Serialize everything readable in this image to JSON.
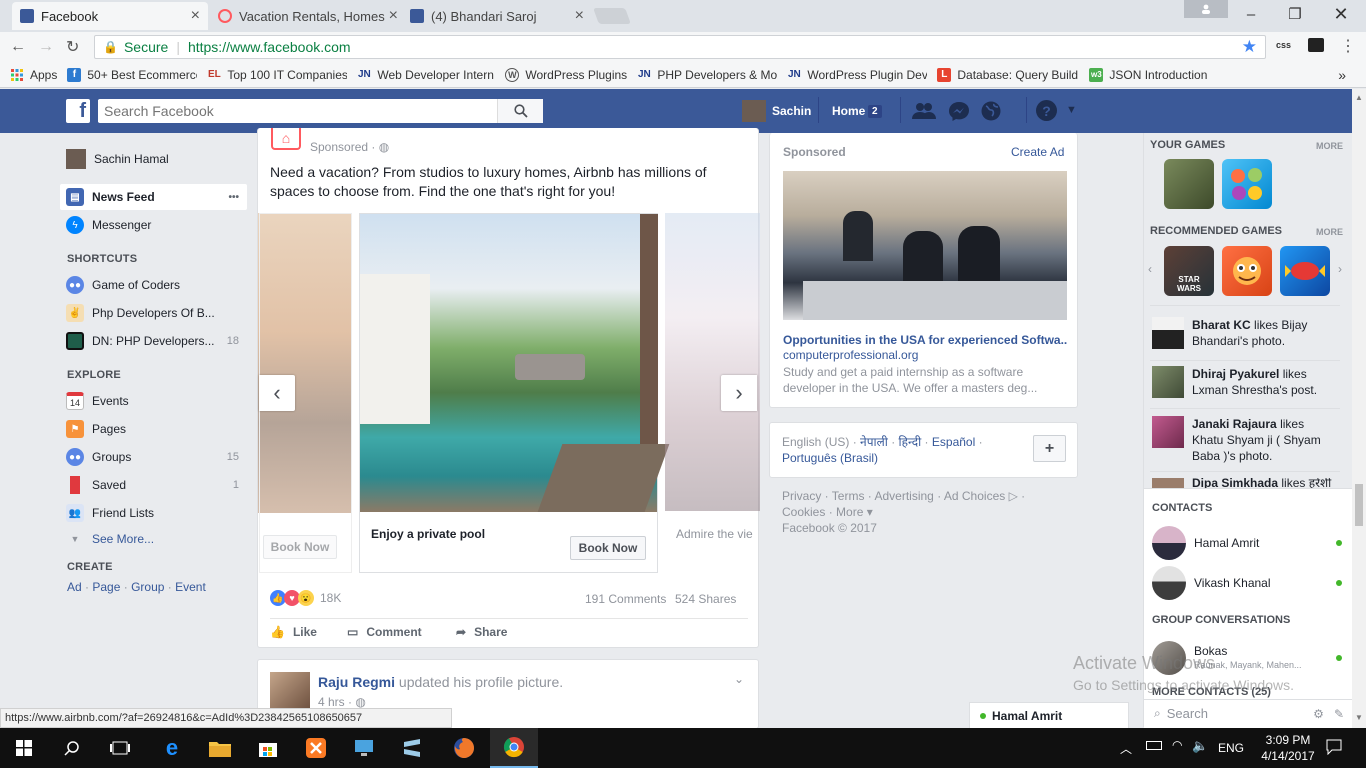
{
  "browser": {
    "tabs": [
      {
        "title": "Facebook",
        "active": true
      },
      {
        "title": "Vacation Rentals, Homes",
        "active": false
      },
      {
        "title": "(4) Bhandari Saroj",
        "active": false
      }
    ],
    "secure_label": "Secure",
    "url": "https://www.facebook.com",
    "status_url": "https://www.airbnb.com/?af=26924816&c=AdId%3D2384256510865065​7",
    "bookmarks": [
      {
        "label": "Apps",
        "icon": "apps-grid-icon"
      },
      {
        "label": "50+ Best Ecommerce",
        "icon": "f-logo-icon"
      },
      {
        "label": "Top 100 IT Companies",
        "icon": "el-logo-icon"
      },
      {
        "label": "Web Developer Intern",
        "icon": "jn-logo-icon"
      },
      {
        "label": "WordPress Plugins",
        "icon": "wordpress-icon"
      },
      {
        "label": "PHP Developers & Mo",
        "icon": "jn-logo-icon"
      },
      {
        "label": "WordPress Plugin Dev",
        "icon": "jn-logo-icon"
      },
      {
        "label": "Database: Query Build",
        "icon": "laravel-icon"
      },
      {
        "label": "JSON Introduction",
        "icon": "w3-icon"
      }
    ]
  },
  "header": {
    "search_placeholder": "Search Facebook",
    "user_name": "Sachin",
    "home_label": "Home",
    "home_count": "2"
  },
  "left_nav": {
    "profile_name": "Sachin Hamal",
    "main": [
      {
        "label": "News Feed",
        "more": "•••"
      },
      {
        "label": "Messenger"
      }
    ],
    "shortcuts_title": "SHORTCUTS",
    "shortcuts": [
      {
        "label": "Game of Coders",
        "count": ""
      },
      {
        "label": "Php Developers Of B...",
        "count": ""
      },
      {
        "label": "DN: PHP Developers...",
        "count": "18"
      }
    ],
    "explore_title": "EXPLORE",
    "explore": [
      {
        "label": "Events",
        "count": "",
        "icon_text": "14"
      },
      {
        "label": "Pages",
        "count": ""
      },
      {
        "label": "Groups",
        "count": "15"
      },
      {
        "label": "Saved",
        "count": "1"
      },
      {
        "label": "Friend Lists",
        "count": ""
      }
    ],
    "see_more": "See More...",
    "create_title": "CREATE",
    "create_links": [
      "Ad",
      "Page",
      "Group",
      "Event"
    ]
  },
  "post": {
    "sponsored": "Sponsored",
    "text": "Need a vacation? From studios to luxury homes, Airbnb has millions of spaces to choose from. Find the one that's right for you!",
    "carousel": [
      {
        "caption": "",
        "button": "Book Now"
      },
      {
        "caption": "Enjoy a private pool",
        "button": "Book Now"
      },
      {
        "caption": "Admire the vie",
        "button": ""
      }
    ],
    "reactions_count": "18K",
    "comments": "191 Comments",
    "shares": "524 Shares",
    "actions": [
      "Like",
      "Comment",
      "Share"
    ]
  },
  "post2": {
    "author": "Raju Regmi",
    "action": "updated his profile picture.",
    "time": "4 hrs"
  },
  "ad": {
    "sponsored": "Sponsored",
    "create_ad": "Create Ad",
    "title": "Opportunities in the USA for experienced Softwa...",
    "domain": "computerprofessional.org",
    "description": "Study and get a paid internship as a software developer in the USA. We offer a masters deg..."
  },
  "languages": {
    "current": "English (US)",
    "others": [
      "नेपाली",
      "हिन्दी",
      "Español",
      "Português (Brasil)"
    ],
    "add": "+"
  },
  "footer_links": {
    "line1": [
      "Privacy",
      "Terms",
      "Advertising",
      "Ad Choices"
    ],
    "line2": [
      "Cookies",
      "More"
    ],
    "copyright": "Facebook © 2017"
  },
  "right_col": {
    "your_games": "YOUR GAMES",
    "more1": "MORE",
    "recommended_games": "RECOMMENDED GAMES",
    "more2": "MORE",
    "ticker": [
      {
        "name": "Bharat KC",
        "text": "likes Bijay Bhandari's photo."
      },
      {
        "name": "Dhiraj Pyakurel",
        "text": "likes Lxman Shrestha's post."
      },
      {
        "name": "Janaki Rajaura",
        "text": "likes Khatu Shyam ji ( Shyam Baba )'s photo."
      },
      {
        "name": "Dipa Simkhada",
        "text": "likes हरेशी"
      }
    ],
    "contacts_title": "CONTACTS",
    "contacts": [
      "Hamal Amrit",
      "Vikash Khanal"
    ],
    "group_conv_title": "GROUP CONVERSATIONS",
    "group_name": "Bokas",
    "group_members": "Raunak, Mayank, Mahen...",
    "more_contacts": "MORE CONTACTS (25)",
    "chat_search": "Search"
  },
  "chat_tab": "Hamal Amrit",
  "watermark": {
    "line1": "Activate Windows",
    "line2": "Go to Settings to activate Windows."
  },
  "taskbar": {
    "language": "ENG",
    "time": "3:09 PM",
    "date": "4/14/2017"
  }
}
